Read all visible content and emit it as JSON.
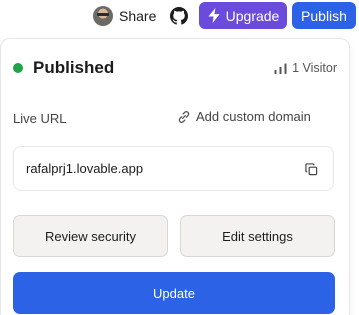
{
  "topbar": {
    "share_label": "Share",
    "upgrade_label": "Upgrade",
    "publish_label": "Publish",
    "colors": {
      "upgrade": "#6a4bdc",
      "publish": "#2b62e6"
    }
  },
  "panel": {
    "status": "Published",
    "status_color": "#22a24a",
    "visitors": "1 Visitor",
    "live_url_label": "Live URL",
    "custom_domain_label": "Add custom domain",
    "url_value": "rafalprj1.lovable.app",
    "review_security_label": "Review security",
    "edit_settings_label": "Edit settings",
    "update_label": "Update"
  }
}
